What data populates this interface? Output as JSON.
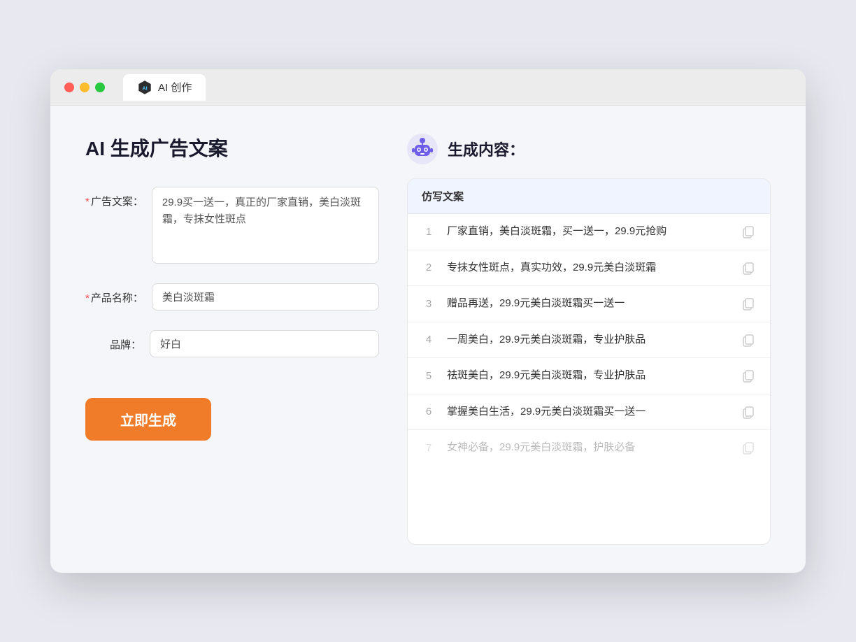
{
  "window": {
    "tab_label": "AI 创作"
  },
  "left_panel": {
    "title": "AI 生成广告文案",
    "fields": [
      {
        "label": "广告文案：",
        "required": true,
        "type": "textarea",
        "value": "29.9买一送一，真正的厂家直销，美白淡斑霜，专抹女性斑点",
        "name": "ad-copy-input"
      },
      {
        "label": "产品名称：",
        "required": true,
        "type": "text",
        "value": "美白淡斑霜",
        "name": "product-name-input"
      },
      {
        "label": "品牌：",
        "required": false,
        "type": "text",
        "value": "好白",
        "name": "brand-input"
      }
    ],
    "generate_button": "立即生成"
  },
  "right_panel": {
    "title": "生成内容：",
    "table_header": "仿写文案",
    "results": [
      {
        "index": 1,
        "text": "厂家直销，美白淡斑霜，买一送一，29.9元抢购",
        "faded": false
      },
      {
        "index": 2,
        "text": "专抹女性斑点，真实功效，29.9元美白淡斑霜",
        "faded": false
      },
      {
        "index": 3,
        "text": "赠品再送，29.9元美白淡斑霜买一送一",
        "faded": false
      },
      {
        "index": 4,
        "text": "一周美白，29.9元美白淡斑霜，专业护肤品",
        "faded": false
      },
      {
        "index": 5,
        "text": "祛斑美白，29.9元美白淡斑霜，专业护肤品",
        "faded": false
      },
      {
        "index": 6,
        "text": "掌握美白生活，29.9元美白淡斑霜买一送一",
        "faded": false
      },
      {
        "index": 7,
        "text": "女神必备，29.9元美白淡斑霜，护肤必备",
        "faded": true
      }
    ]
  }
}
